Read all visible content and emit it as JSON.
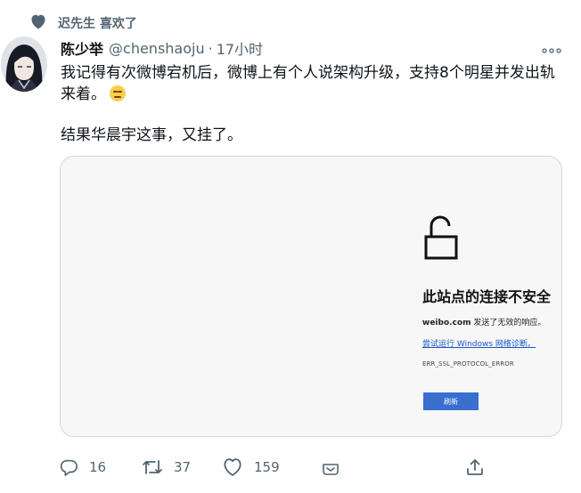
{
  "social_context": {
    "icon": "heart-filled-icon",
    "text": "迟先生 喜欢了"
  },
  "tweet": {
    "author_name": "陈少举",
    "handle": "@chenshaoju",
    "separator": "·",
    "time": "17小时",
    "text_line1": "我记得有次微博宕机后，微博上有个人说架构升级，支持8个明星并发出轨来着。",
    "emoji": "expressionless-face-emoji",
    "text_line2": "结果华晨宇这事，又挂了。"
  },
  "media": {
    "error_page": {
      "icon": "unlocked-padlock-icon",
      "title": "此站点的连接不安全",
      "desc_domain": "weibo.com",
      "desc_rest": " 发送了无效的响应。",
      "link_text": "尝试运行 Windows 网络诊断",
      "link_suffix": "。",
      "error_code": "ERR_SSL_PROTOCOL_ERROR",
      "button_label": "刷新"
    }
  },
  "actions": {
    "reply": {
      "icon": "reply-icon",
      "count": "16"
    },
    "retweet": {
      "icon": "retweet-icon",
      "count": "37"
    },
    "like": {
      "icon": "heart-icon",
      "count": "159"
    },
    "react": {
      "icon": "emoji-react-icon"
    },
    "share": {
      "icon": "share-icon"
    }
  },
  "colors": {
    "secondary_text": "#536471",
    "link": "#1a56c6",
    "button": "#3a6fd0",
    "border": "#cfd9de"
  }
}
